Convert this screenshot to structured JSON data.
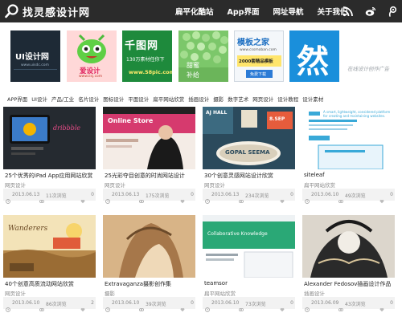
{
  "header": {
    "logo_text": "找灵感设计网",
    "nav": [
      "扁平化酷站",
      "App界面",
      "网址导航",
      "关于我们"
    ],
    "icons": [
      "rss-icon",
      "weibo-icon",
      "tencent-weibo-icon"
    ]
  },
  "banner": {
    "ads": [
      {
        "caption": "UI设计网",
        "sub": "www.uisdc.com"
      },
      {
        "caption": "爱设计",
        "sub": "www.iisj.com"
      },
      {
        "caption": "千图网",
        "line2": "130万素材任你下",
        "line3": "www.58pic.com"
      },
      {
        "caption": "甜蜜",
        "line2": "补给"
      },
      {
        "caption": "模板之家",
        "line2": "www.cssmoban.com",
        "line3": "2000套精品模板",
        "button": "免费下载"
      },
      {
        "caption": "然"
      }
    ],
    "script_text": "在线设计创作广告"
  },
  "categories": [
    "APP界面",
    "UI设计",
    "产品/工业",
    "名片设计",
    "图标设计",
    "平面设计",
    "扁平网站欣赏",
    "插画设计",
    "摄影",
    "数字艺术",
    "网页设计",
    "设计教程",
    "设计素材"
  ],
  "cards": [
    {
      "title": "25个优秀的iPad App应用网站欣赏",
      "category": "网页设计",
      "date": "2013.06.13",
      "views": "11次浏览",
      "likes": "0",
      "thumb_text": "dribbble",
      "accent": "#2b5c9a"
    },
    {
      "title": "25光彩夺目创意的时尚网站设计",
      "category": "网页设计",
      "date": "2013.06.13",
      "views": "175次浏览",
      "likes": "0",
      "thumb_text": "Online Store",
      "accent": "#d63a6e"
    },
    {
      "title": "30个创意灵感网站设计欣赏",
      "category": "网页设计",
      "date": "2013.06.13",
      "views": "234次浏览",
      "likes": "0",
      "thumb_text": "GOPAL SEEMA",
      "thumb_text2": "AJ HALL",
      "thumb_text3": "8.SEP",
      "accent": "#2b4a5c"
    },
    {
      "title": "siteleaf",
      "category": "扁平网站欣赏",
      "date": "2013.06.10",
      "views": "49次浏览",
      "likes": "0",
      "thumb_text": "A smart, lightweight, considered platform for creating and maintaining websites.",
      "accent": "#39a9d8"
    },
    {
      "title": "40个创意高质流动网站欣赏",
      "category": "网页设计",
      "date": "2013.06.10",
      "views": "86次浏览",
      "likes": "2",
      "thumb_text": "Wanderers",
      "accent": "#f3e3b8"
    },
    {
      "title": "Extravaganza摄影创作集",
      "category": "摄影",
      "date": "2013.06.10",
      "views": "39次浏览",
      "likes": "0",
      "thumb_text": "",
      "accent": "#c9a070"
    },
    {
      "title": "teamsor",
      "category": "扁平网站欣赏",
      "date": "2013.06.10",
      "views": "73次浏览",
      "likes": "0",
      "thumb_text": "Collaborative Knowledge",
      "accent": "#2aa876"
    },
    {
      "title": "Alexander Fedosov插画设计作品",
      "category": "插画设计",
      "date": "2013.06.09",
      "views": "43次浏览",
      "likes": "0",
      "thumb_text": "",
      "accent": "#3a3a3a"
    }
  ]
}
